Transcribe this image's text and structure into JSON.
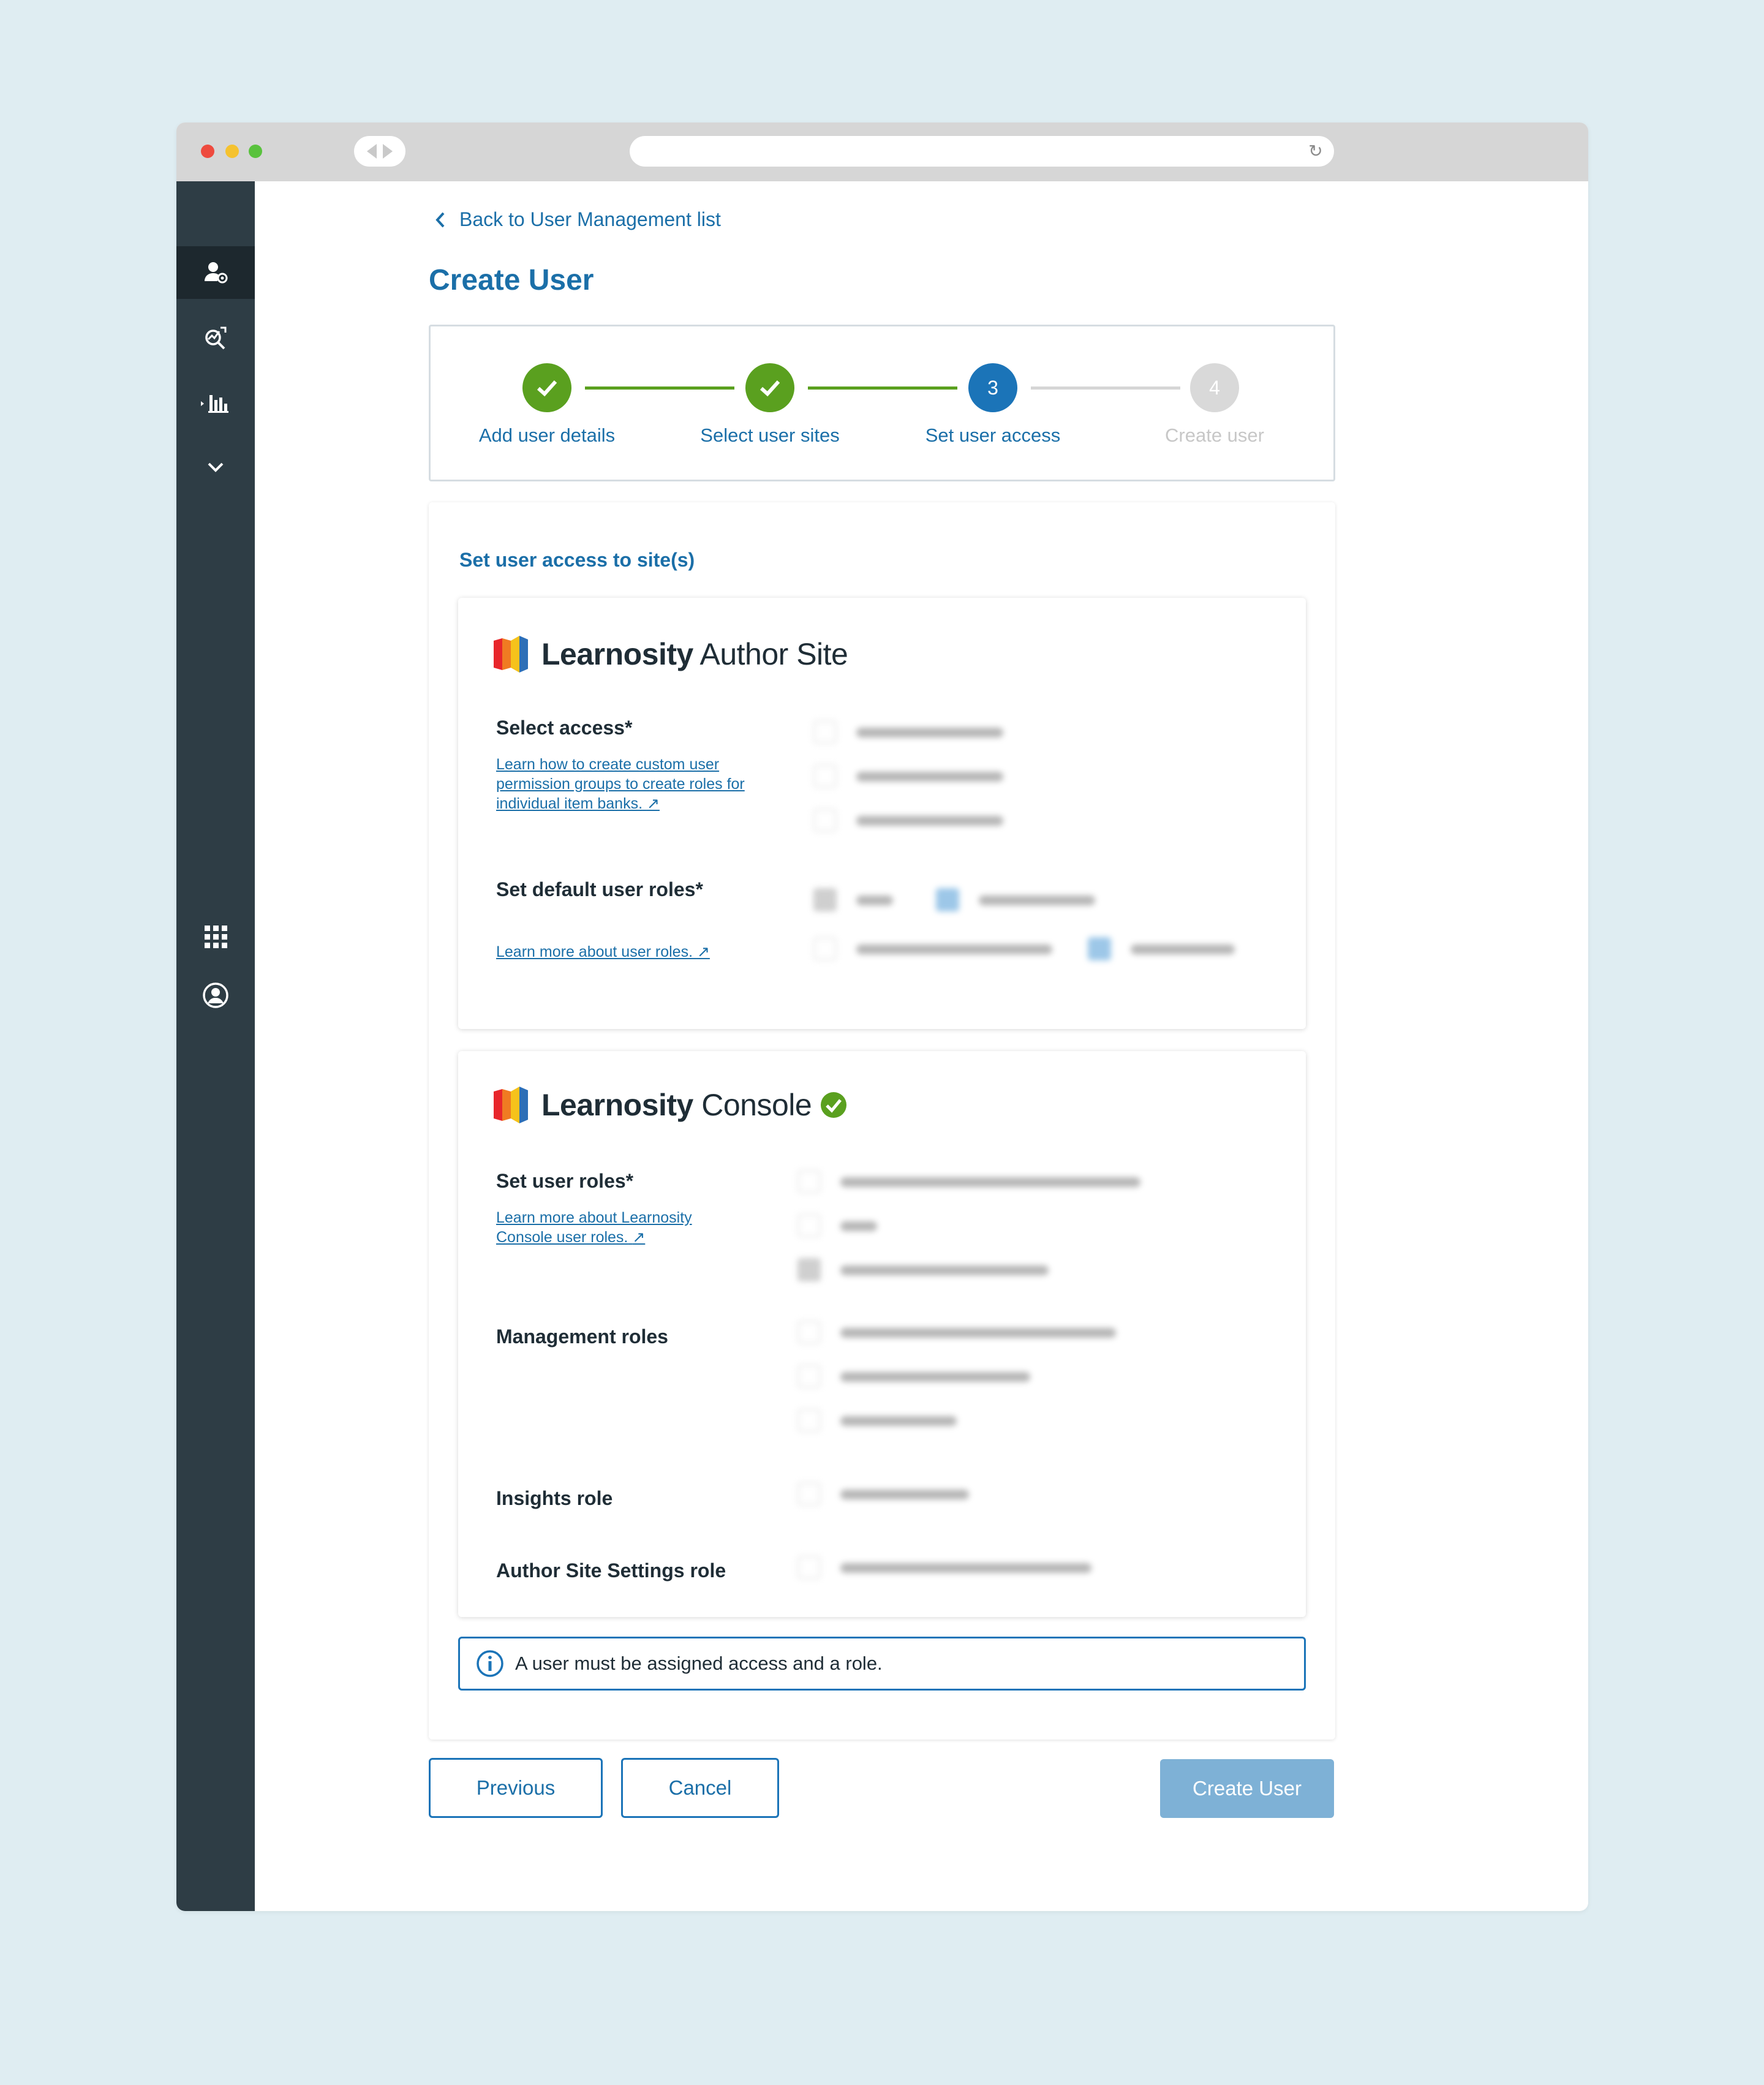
{
  "back_link": "Back to User Management list",
  "page_title": "Create User",
  "steps": [
    {
      "label": "Add user details",
      "state": "done"
    },
    {
      "label": "Select user sites",
      "state": "done"
    },
    {
      "number": "3",
      "label": "Set user access",
      "state": "current"
    },
    {
      "number": "4",
      "label": "Create user",
      "state": "todo"
    }
  ],
  "section_heading": "Set user access to site(s)",
  "author_site": {
    "brand_bold": "Learnosity",
    "brand_rest": " Author Site",
    "select_access_label": "Select access*",
    "select_access_help": "Learn how to create custom user permission groups to create roles for individual item banks.",
    "default_roles_label": "Set default user roles*",
    "default_roles_help": "Learn more about user roles."
  },
  "console": {
    "brand_bold": "Learnosity",
    "brand_rest": " Console",
    "user_roles_label": "Set user roles*",
    "user_roles_help": "Learn more about Learnosity Console user roles.",
    "management_roles_label": "Management roles",
    "insights_role_label": "Insights role",
    "author_settings_label": "Author Site Settings role"
  },
  "notice_text": "A user must be assigned access and a role.",
  "buttons": {
    "previous": "Previous",
    "cancel": "Cancel",
    "create": "Create User"
  },
  "colors": {
    "accent": "#1b6fa8",
    "success": "#5aa01f",
    "sidebar": "#2e3d45",
    "disabled_primary": "#7eb1d6"
  }
}
